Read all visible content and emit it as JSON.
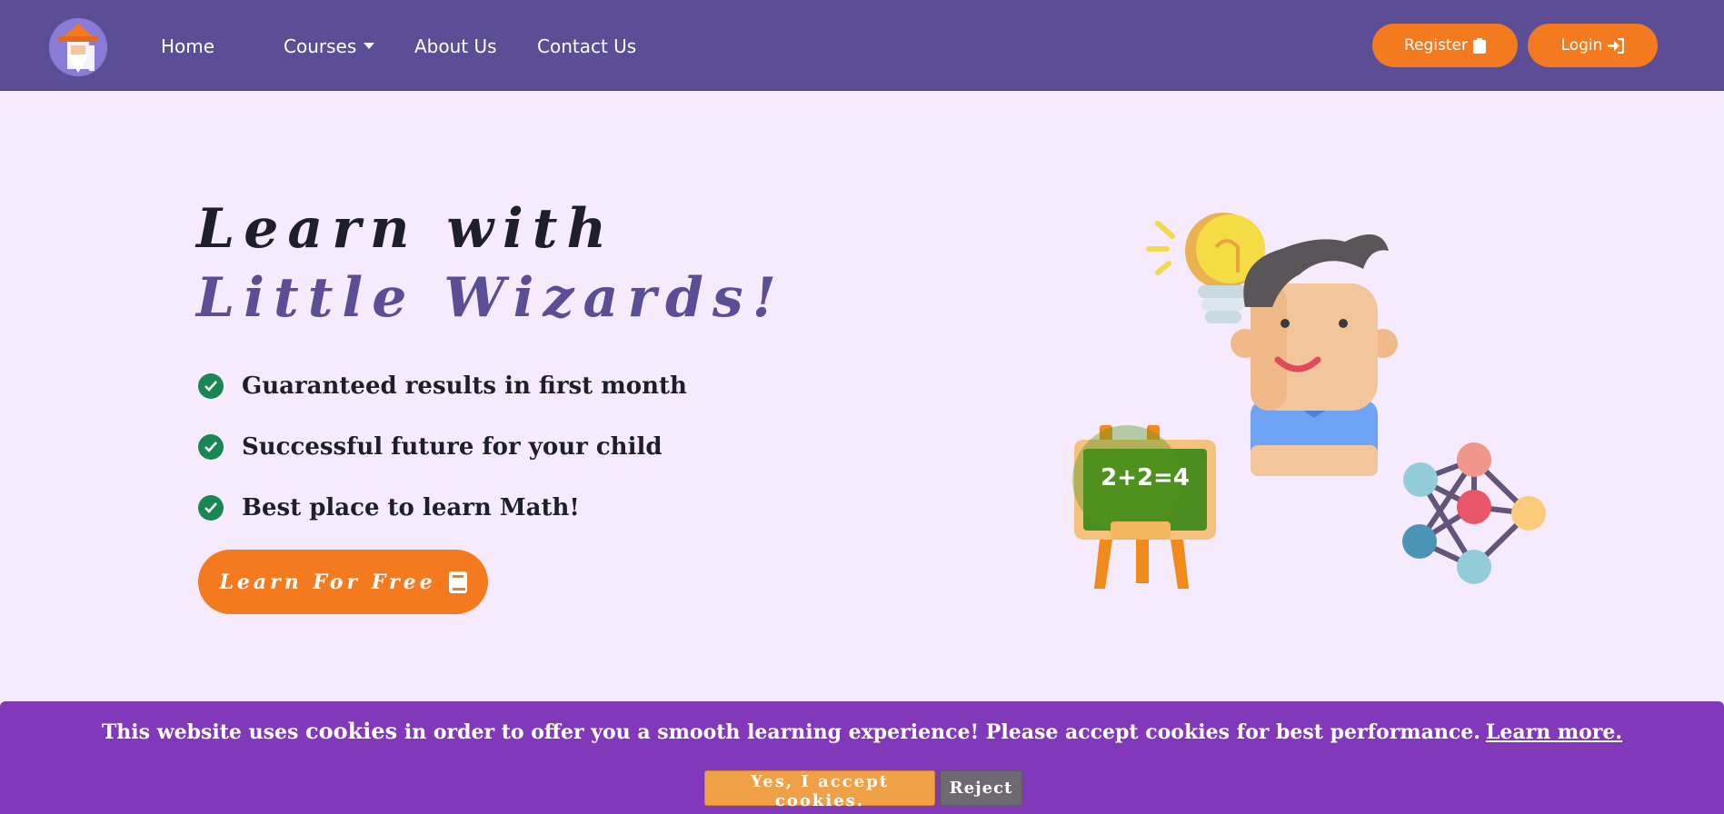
{
  "navbar": {
    "logo_icon": "wizard-logo-icon",
    "links": {
      "home": "Home",
      "courses": "Courses",
      "about": "About Us",
      "contact": "Contact Us"
    },
    "register_label": "Register",
    "register_icon": "clipboard-icon",
    "login_label": "Login",
    "login_icon": "sign-in-icon",
    "background_color": "#5b4e96",
    "accent_color": "#f47a1f"
  },
  "hero": {
    "title_line1": "Learn with",
    "title_line2": "Little Wizards!",
    "features": [
      "Guaranteed results in first month",
      "Successful future for your child",
      "Best place to learn Math!"
    ],
    "feature_icon": "check-circle-icon",
    "cta_label": "Learn For Free",
    "cta_icon": "book-icon",
    "background_color": "#f5ebfd"
  },
  "illustration": {
    "chalkboard_text": "2+2=4"
  },
  "cookie_banner": {
    "text_before": "This website uses ",
    "text_strong": "cookies",
    "text_after": " in order to offer you a smooth learning experience! Please accept cookies for best performance.",
    "learn_more": "Learn more.",
    "accept_label": "Yes, I accept cookies.",
    "reject_label": "Reject",
    "background_color": "#8239b9"
  }
}
